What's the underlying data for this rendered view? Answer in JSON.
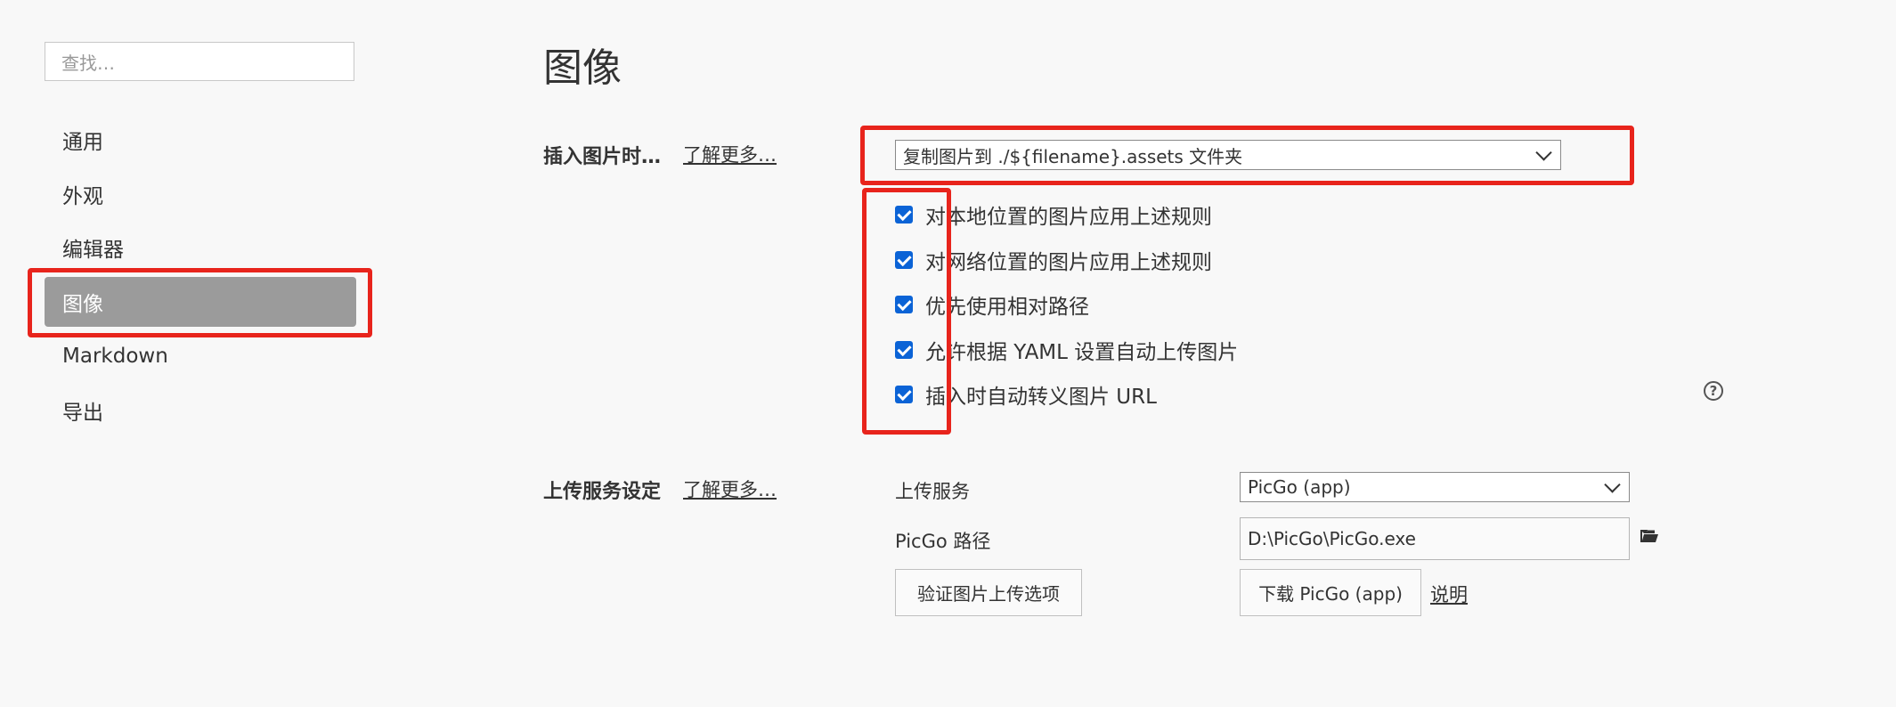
{
  "sidebar": {
    "search_placeholder": "查找…",
    "items": [
      {
        "label": "通用"
      },
      {
        "label": "外观"
      },
      {
        "label": "编辑器"
      },
      {
        "label": "图像"
      },
      {
        "label": "Markdown"
      },
      {
        "label": "导出"
      }
    ],
    "active_item": "图像"
  },
  "main": {
    "title": "图像",
    "insert_section": {
      "label": "插入图片时…",
      "learn_more": "了解更多…",
      "select_value": "复制图片到 ./${filename}.assets 文件夹",
      "options": [
        {
          "label": "对本地位置的图片应用上述规则",
          "checked": true
        },
        {
          "label": "对网络位置的图片应用上述规则",
          "checked": true
        },
        {
          "label": "优先使用相对路径",
          "checked": true
        },
        {
          "label": "允许根据 YAML 设置自动上传图片",
          "checked": true
        },
        {
          "label": "插入时自动转义图片 URL",
          "checked": true
        }
      ],
      "help_glyph": "?"
    },
    "upload_section": {
      "label": "上传服务设定",
      "learn_more": "了解更多…",
      "service_label": "上传服务",
      "service_value": "PicGo (app)",
      "path_label": "PicGo 路径",
      "path_value": "D:\\PicGo\\PicGo.exe",
      "verify_button": "验证图片上传选项",
      "download_button": "下载 PicGo (app)",
      "desc_link": "说明"
    }
  },
  "colors": {
    "highlight": "#e8241c",
    "active_nav": "#9b9b9b",
    "checkbox": "#0b63d6"
  }
}
